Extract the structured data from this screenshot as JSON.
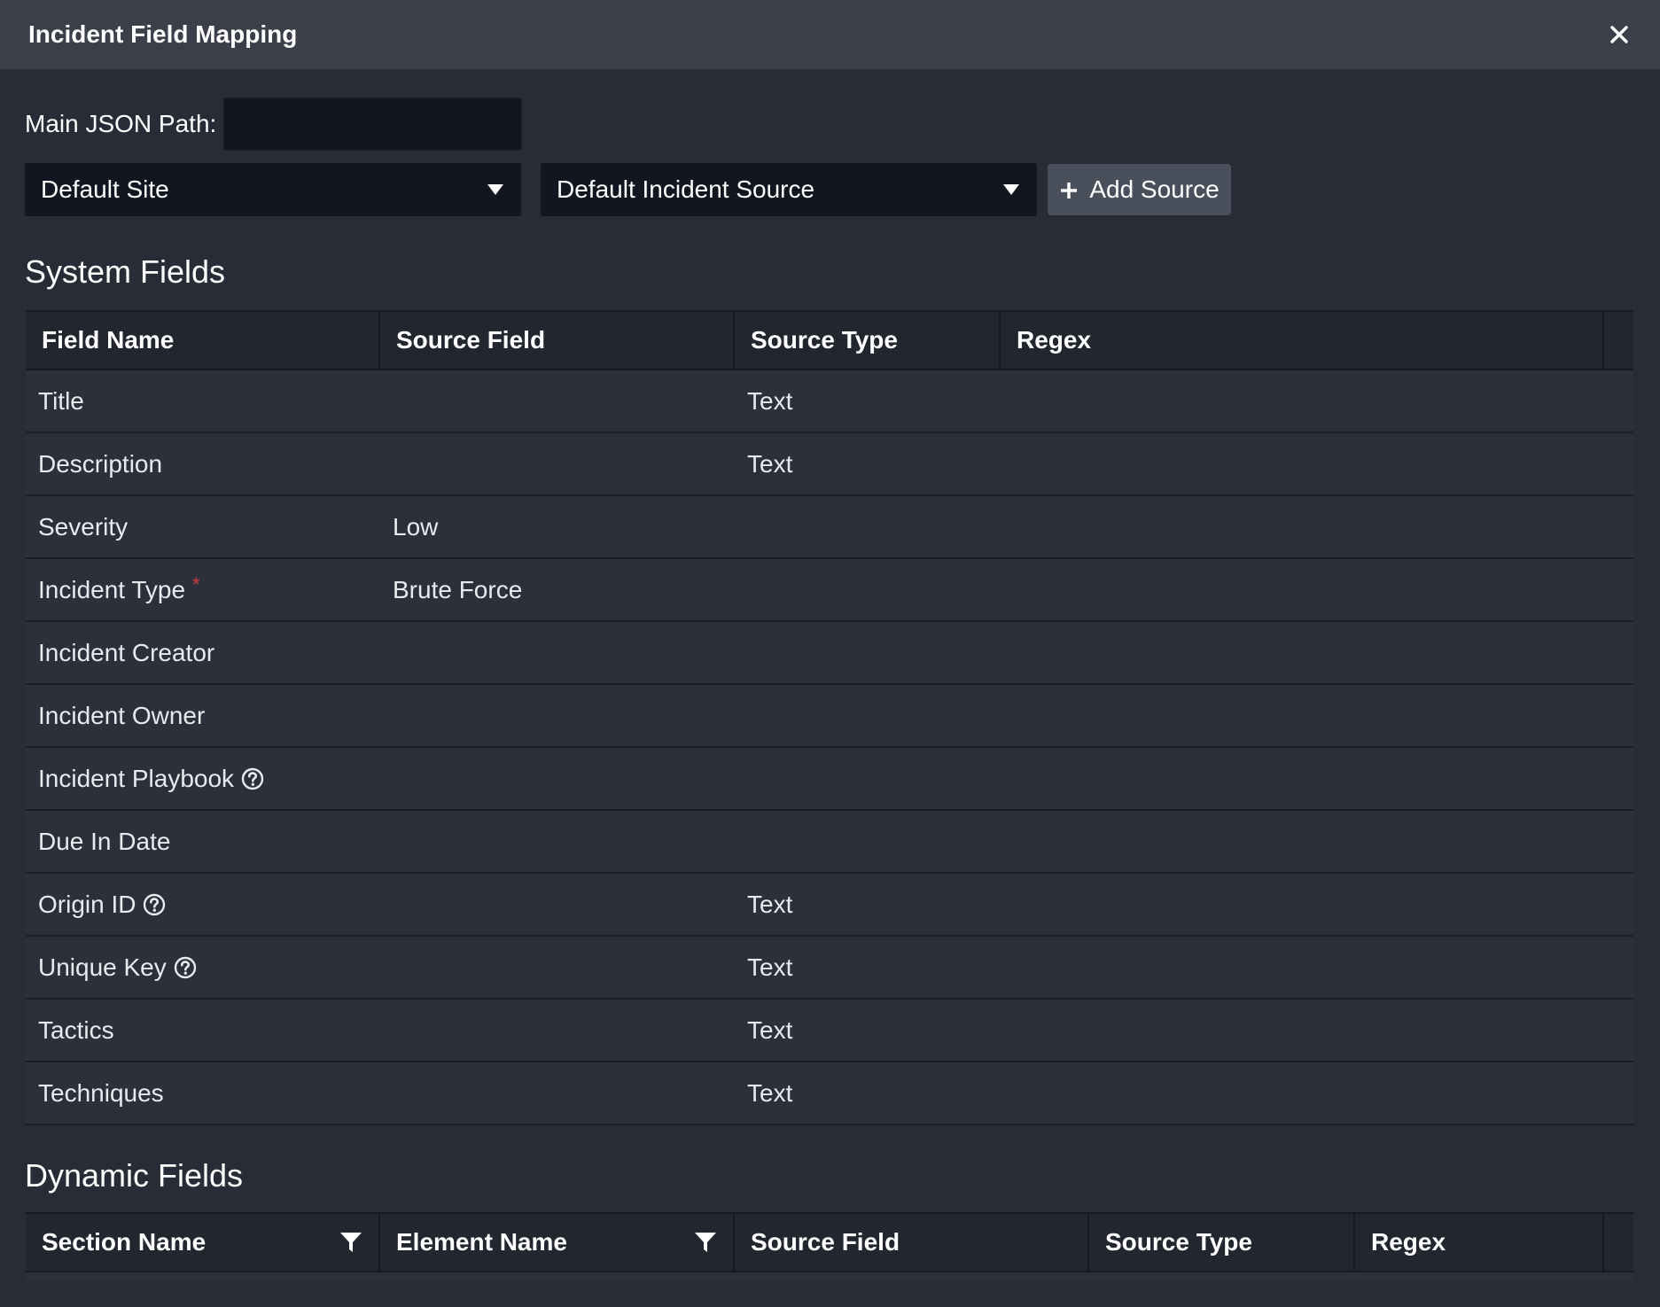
{
  "header": {
    "title": "Incident Field Mapping"
  },
  "form": {
    "json_path_label": "Main JSON Path:",
    "json_path_value": "",
    "site_select": "Default Site",
    "source_select": "Default Incident Source",
    "add_source_label": "Add Source"
  },
  "system_fields": {
    "title": "System Fields",
    "columns": [
      "Field Name",
      "Source Field",
      "Source Type",
      "Regex"
    ],
    "rows": [
      {
        "name": "Title",
        "source": "",
        "type": "Text",
        "regex": ""
      },
      {
        "name": "Description",
        "source": "",
        "type": "Text",
        "regex": ""
      },
      {
        "name": "Severity",
        "source": "Low",
        "type": "",
        "regex": ""
      },
      {
        "name": "Incident Type",
        "source": "Brute Force",
        "type": "",
        "regex": "",
        "required": "*"
      },
      {
        "name": "Incident Creator",
        "source": "",
        "type": "",
        "regex": ""
      },
      {
        "name": "Incident Owner",
        "source": "",
        "type": "",
        "regex": ""
      },
      {
        "name": "Incident Playbook",
        "source": "",
        "type": "",
        "regex": ""
      },
      {
        "name": "Due In Date",
        "source": "",
        "type": "",
        "regex": ""
      },
      {
        "name": "Origin ID",
        "source": "",
        "type": "Text",
        "regex": ""
      },
      {
        "name": "Unique Key",
        "source": "",
        "type": "Text",
        "regex": ""
      },
      {
        "name": "Tactics",
        "source": "",
        "type": "Text",
        "regex": ""
      },
      {
        "name": "Techniques",
        "source": "",
        "type": "Text",
        "regex": ""
      }
    ]
  },
  "dynamic_fields": {
    "title": "Dynamic Fields",
    "columns": [
      "Section Name",
      "Element Name",
      "Source Field",
      "Source Type",
      "Regex"
    ]
  },
  "colors": {
    "required": "#d63b3b",
    "header_bg": "#3a3f49",
    "input_bg": "#111620"
  },
  "icons": {
    "close": "close-icon",
    "caret": "caret-down-icon",
    "plus": "plus-icon",
    "help": "question-circle-icon",
    "filter": "filter-icon"
  }
}
